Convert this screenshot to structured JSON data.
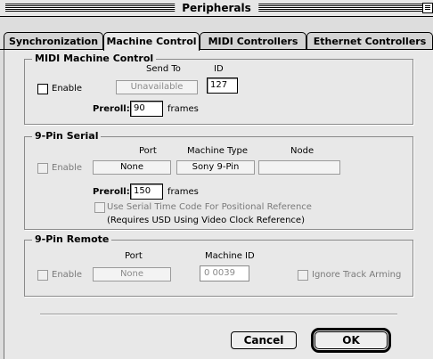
{
  "window": {
    "title": "Peripherals"
  },
  "tabs": [
    {
      "label": "Synchronization",
      "active": false
    },
    {
      "label": "Machine Control",
      "active": true
    },
    {
      "label": "MIDI Controllers",
      "active": false
    },
    {
      "label": "Ethernet Controllers",
      "active": false
    }
  ],
  "midi_machine_control": {
    "title": "MIDI Machine Control",
    "enable_label": "Enable",
    "enable_checked": false,
    "send_to_label": "Send To",
    "send_to_value": "Unavailable",
    "id_label": "ID",
    "id_value": "127",
    "preroll_label": "Preroll:",
    "preroll_value": "90",
    "preroll_unit": "frames"
  },
  "nine_pin_serial": {
    "title": "9-Pin Serial",
    "enable_label": "Enable",
    "enable_checked": false,
    "port_label": "Port",
    "port_value": "None",
    "machine_type_label": "Machine Type",
    "machine_type_value": "Sony 9-Pin",
    "node_label": "Node",
    "node_value": "",
    "preroll_label": "Preroll:",
    "preroll_value": "150",
    "preroll_unit": "frames",
    "serial_tc_label": "Use Serial Time Code For Positional Reference",
    "serial_tc_checked": false,
    "note": "(Requires USD Using Video Clock Reference)"
  },
  "nine_pin_remote": {
    "title": "9-Pin Remote",
    "enable_label": "Enable",
    "enable_checked": false,
    "port_label": "Port",
    "port_value": "None",
    "machine_id_label": "Machine ID",
    "machine_id_value": "0 0039",
    "ignore_arming_label": "Ignore Track Arming",
    "ignore_arming_checked": false
  },
  "buttons": {
    "cancel": "Cancel",
    "ok": "OK"
  }
}
